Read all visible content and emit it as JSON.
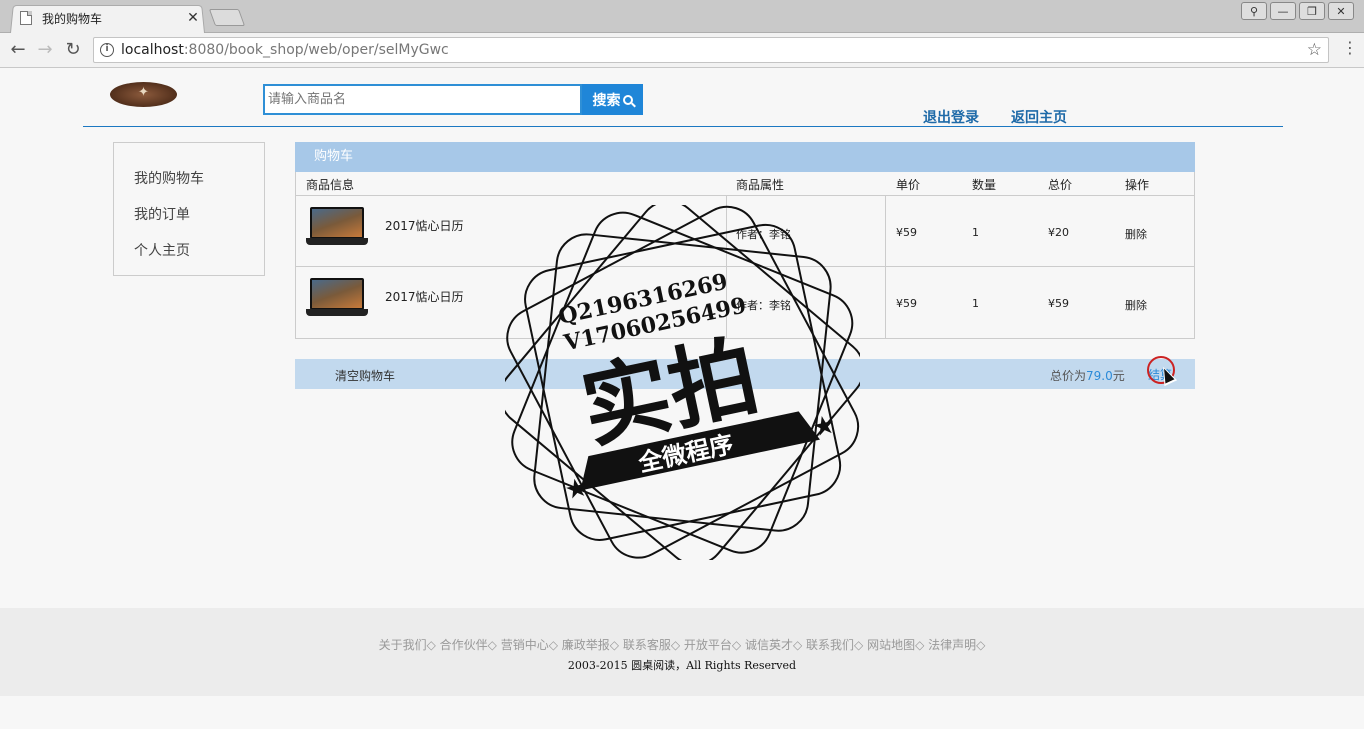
{
  "browser": {
    "tab_title": "我的购物车",
    "tab_close": "✕",
    "url_host": "localhost",
    "url_path": ":8080/book_shop/web/oper/selMyGwc"
  },
  "header": {
    "search_placeholder": "请输入商品名",
    "search_label": "搜索",
    "logout": "退出登录",
    "home": "返回主页"
  },
  "sidebar": {
    "items": [
      "我的购物车",
      "我的订单",
      "个人主页"
    ]
  },
  "cart": {
    "title": "购物车",
    "columns": [
      "商品信息",
      "商品属性",
      "单价",
      "数量",
      "总价",
      "操作"
    ],
    "rows": [
      {
        "name": "2017惦心日历",
        "attr": "作者：李铭",
        "price": "¥59",
        "qty": "1",
        "total": "¥20",
        "action": "删除"
      },
      {
        "name": "2017惦心日历",
        "attr": "作者：李铭",
        "price": "¥59",
        "qty": "1",
        "total": "¥59",
        "action": "删除"
      }
    ],
    "clear": "清空购物车",
    "total_label": "总价为",
    "total_value": "79.0",
    "total_unit": "元",
    "checkout": "结算"
  },
  "watermark": {
    "line1": "Q2196316269",
    "line2": "V17060256499",
    "main": "实拍",
    "banner": "全微程序"
  },
  "footer": {
    "links": [
      "关于我们◇",
      "合作伙伴◇",
      "营销中心◇",
      "廉政举报◇",
      "联系客服◇",
      "开放平台◇",
      "诚信英才◇",
      "联系我们◇",
      "网站地图◇",
      "法律声明◇"
    ],
    "copyright": "2003-2015 圆桌阅读，All Rights Reserved"
  },
  "colors": {
    "accent": "#1f86d8",
    "cart_header": "#a7c8e8",
    "cart_footer": "#c2d9ee",
    "link": "#1e6aa8"
  }
}
